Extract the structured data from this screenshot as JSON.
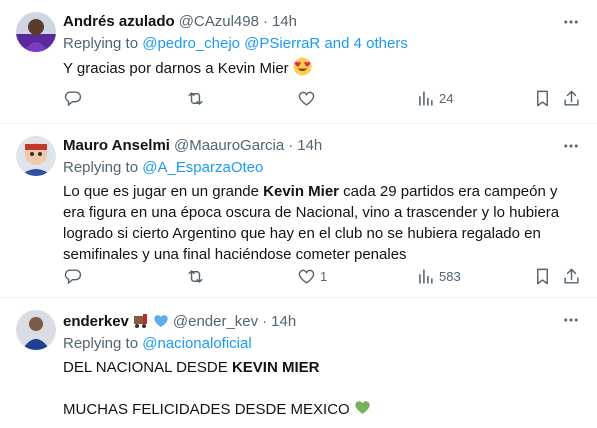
{
  "tweets": [
    {
      "name": "Andrés azulado",
      "handle": "@CAzul498",
      "dot": "·",
      "time": "14h",
      "replying_prefix": "Replying to ",
      "replying_mentions": "@pedro_chejo @PSierraR and 4 others",
      "text": "Y gracias por darnos a Kevin Mier ",
      "emoji": "heart-eyes-emoji",
      "replies": "",
      "retweets": "",
      "likes": "",
      "views": "24"
    },
    {
      "name": "Mauro Anselmi",
      "handle": "@MaauroGarcia",
      "dot": "·",
      "time": "14h",
      "replying_prefix": "Replying to ",
      "replying_mentions": "@A_EsparzaOteo",
      "text_before": "Lo que es jugar en un grande ",
      "text_bold": "Kevin Mier",
      "text_after": " cada 29 partidos era campeón y era figura en una época oscura de Nacional, vino a trascender y lo hubiera logrado si cierto Argentino que hay en el club no se hubiera regalado en semifinales y una final haciéndose cometer penales",
      "replies": "",
      "retweets": "",
      "likes": "1",
      "views": "583"
    },
    {
      "name": "enderkev",
      "handle": "@ender_kev",
      "dot": "·",
      "time": "14h",
      "replying_prefix": "Replying to ",
      "replying_mentions": "@nacionaloficial",
      "line1_before": "DEL NACIONAL DESDE ",
      "line1_bold": "KEVIN MIER",
      "line2": "MUCHAS FELICIDADES DESDE MEXICO ",
      "emoji": "green-heart-emoji"
    }
  ],
  "colors": {
    "accent": "#1d9bf0",
    "secondary_text": "#536471",
    "divider": "#eff3f4"
  }
}
